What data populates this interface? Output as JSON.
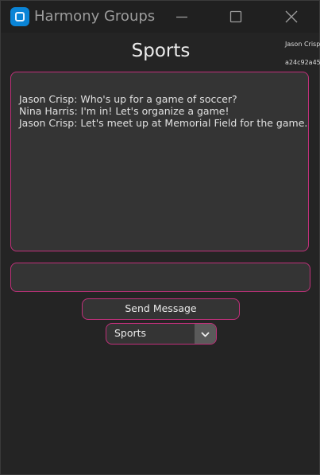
{
  "window": {
    "title": "Harmony Groups",
    "app_icon": "app-logo-icon",
    "controls": {
      "minimize_icon": "minimize-icon",
      "maximize_icon": "maximize-icon",
      "close_icon": "close-icon"
    }
  },
  "user": {
    "name": "Jason Crisp",
    "id": "a24c92a45"
  },
  "group": {
    "title": "Sports"
  },
  "chat": {
    "messages": [
      "Jason Crisp: Who's up for a game of soccer?",
      "Nina Harris: I'm in! Let's organize a game!",
      "Jason Crisp: Let's meet up at Memorial Field for the game."
    ]
  },
  "composer": {
    "value": "",
    "send_label": "Send Message"
  },
  "group_select": {
    "selected": "Sports",
    "arrow_icon": "chevron-down-icon"
  },
  "colors": {
    "accent": "#c0307a",
    "background": "#242424",
    "field": "#343434"
  }
}
